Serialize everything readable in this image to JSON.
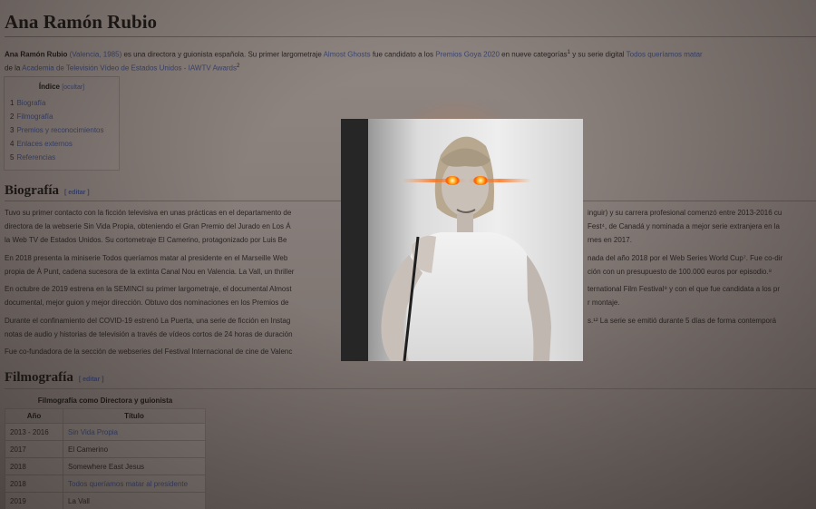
{
  "article": {
    "title": "Ana Ramón Rubio",
    "lead": {
      "name": "Ana Ramón Rubio",
      "birth": "(Valencia, 1985)",
      "text1": " es una directora y guionista española. Su primer largometraje ",
      "film": "Almost Ghosts",
      "text2": " fue candidato a los ",
      "award": "Premios Goya 2020",
      "text3": " en nueve categorías",
      "sup1": "1",
      "text4": " y su serie digital ",
      "series": "Todos queríamos matar",
      "line2_pre": "de la ",
      "academy": "Academia de Televisión Vídeo de Estados Unidos - IAWTV Awards",
      "sup2": "2"
    }
  },
  "toc": {
    "heading": "Índice",
    "toggle": "[ocultar]",
    "items": [
      {
        "num": "1",
        "label": "Biografía"
      },
      {
        "num": "2",
        "label": "Filmografía"
      },
      {
        "num": "3",
        "label": "Premios y reconocimientos"
      },
      {
        "num": "4",
        "label": "Enlaces externos"
      },
      {
        "num": "5",
        "label": "Referencias"
      }
    ]
  },
  "biografia": {
    "heading": "Biografía",
    "edit": "[ editar ]",
    "lines": [
      "Tuvo su primer contacto con la ficción televisiva en unas prácticas en el departamento de",
      "directora de la webserie Sin Vida Propia, obteniendo el Gran Premio del Jurado en Los Á",
      "la Web TV de Estados Unidos. Su cortometraje El Camerino, protagonizado por Luis Be",
      "En 2018 presenta la miniserie Todos queríamos matar al presidente en el Marseille Web",
      "propia de À Punt, cadena sucesora de la extinta Canal Nou en Valencia. La Vall, un thriller",
      "En octubre de 2019 estrena en la SEMINCI su primer largometraje, el documental Almost",
      "documental, mejor guion y mejor dirección. Obtuvo dos nominaciones en los Premios de",
      "Durante el confinamiento del COVID-19 estrenó La Puerta, una serie de ficción en Instag",
      "notas de audio y historias de televisión a través de vídeos cortos de 24 horas de duración",
      "Fue co-fundadora de la sección de webseries del Festival Internacional de cine de Valenc"
    ],
    "right_lines": [
      "inguir) y su carrera profesional comenzó entre 2013-2016 cu",
      "Fest⁴, de Canadá y nominada a mejor serie extranjera en la",
      "rnes en 2017.",
      "nada del año 2018 por el Web Series World Cup⁷. Fue co-dir",
      "ción con un presupuesto de 100.000 euros por episodio.⁸",
      "ternational Film Festival⁹ y con el que fue candidata a los pr",
      "r montaje.",
      "s.¹² La serie se emitió durante 5 días de forma contemporá"
    ]
  },
  "filmografia": {
    "heading": "Filmografía",
    "edit": "[ editar ]",
    "table_caption": "Filmografía como Directora y guionista",
    "columns": [
      "Año",
      "Título"
    ],
    "rows": [
      {
        "year": "2013 - 2016",
        "title": "Sin Vida Propia",
        "link": true
      },
      {
        "year": "2017",
        "title": "El Camerino",
        "link": false
      },
      {
        "year": "2018",
        "title": "Somewhere East Jesus",
        "link": false
      },
      {
        "year": "2018",
        "title": "Todos queríamos matar al presidente",
        "link": true
      },
      {
        "year": "2019",
        "title": "La Vall",
        "link": false
      }
    ]
  },
  "overlay": {
    "photo_desc_icon": "portrait-photo-icon"
  },
  "colors": {
    "link": "#3e4a78",
    "eye_glow": "#ff6a00"
  }
}
